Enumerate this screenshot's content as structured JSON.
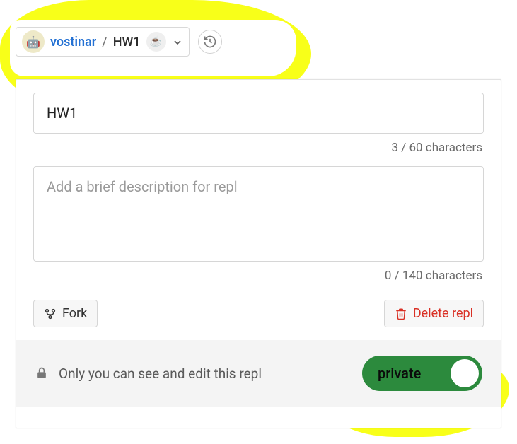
{
  "breadcrumb": {
    "username": "vostinar",
    "separator": "/",
    "repl_name": "HW1",
    "avatar_emoji": "🤖",
    "lang_emoji": "☕"
  },
  "fields": {
    "title_value": "HW1",
    "title_count": "3 / 60 characters",
    "description_value": "",
    "description_placeholder": "Add a brief description for repl",
    "description_count": "0 / 140 characters"
  },
  "actions": {
    "fork_label": "Fork",
    "delete_label": "Delete repl"
  },
  "privacy": {
    "message": "Only you can see and edit this repl",
    "toggle_label": "private"
  }
}
